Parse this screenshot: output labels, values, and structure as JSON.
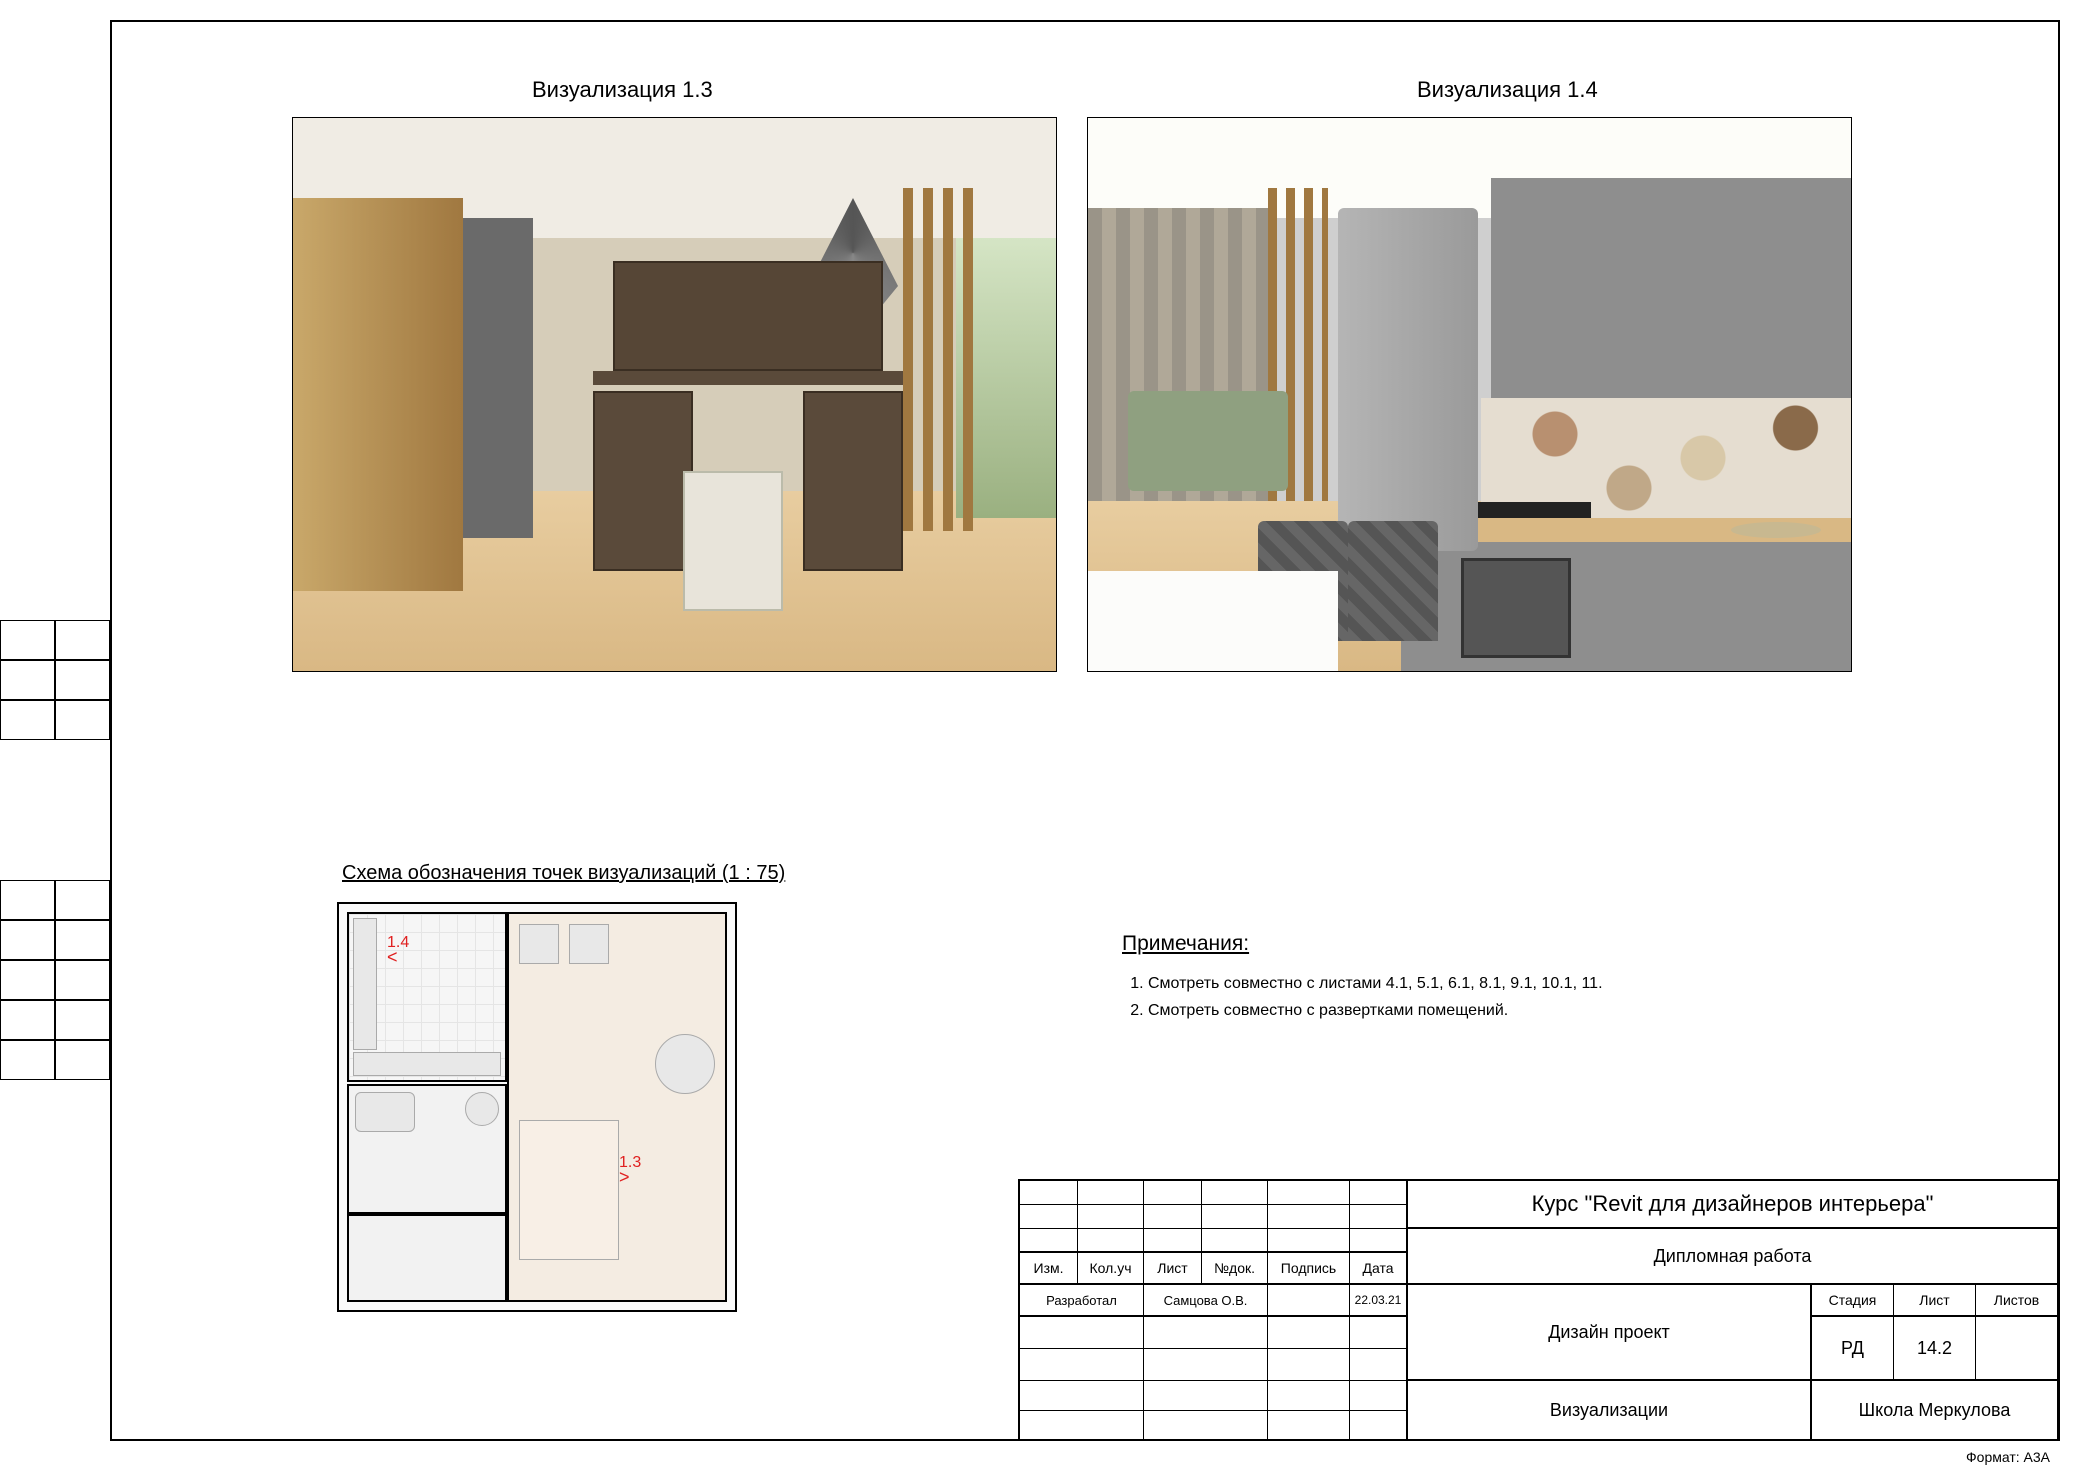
{
  "vis_titles": {
    "v1": "Визуализация 1.3",
    "v2": "Визуализация 1.4"
  },
  "scheme_title": "Схема обозначения точек визуализаций (1 : 75)",
  "markers": {
    "m13": "1.3",
    "m14": "1.4"
  },
  "notes": {
    "heading": "Примечания:",
    "items": [
      "Смотреть совместно с листами 4.1, 5.1, 6.1, 8.1, 9.1, 10.1, 11.",
      "Смотреть совместно с развертками помещений."
    ]
  },
  "titleblock": {
    "hdr_izm": "Изм.",
    "hdr_koluch": "Кол.уч",
    "hdr_list": "Лист",
    "hdr_ndok": "№док.",
    "hdr_podpis": "Подпись",
    "hdr_data": "Дата",
    "row_razrab": "Разработал",
    "author": "Самцова О.В.",
    "date": "22.03.21",
    "project_title": "Курс \"Revit для дизайнеров интерьера\"",
    "project_sub": "Дипломная работа",
    "drawing_title": "Дизайн проект",
    "sheet_content": "Визуализации",
    "stage_hdr": "Стадия",
    "sheet_hdr": "Лист",
    "sheets_hdr": "Листов",
    "stage": "РД",
    "sheet_no": "14.2",
    "school": "Школа Меркулова"
  },
  "format": "Формат: A3A"
}
